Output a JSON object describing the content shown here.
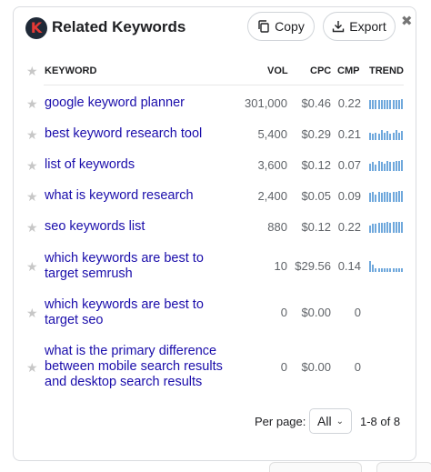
{
  "header": {
    "logo_letter": "K",
    "title": "Related Keywords",
    "copy_label": "Copy",
    "export_label": "Export",
    "close_glyph": "✖"
  },
  "columns": {
    "keyword": "KEYWORD",
    "vol": "VOL",
    "cpc": "CPC",
    "cmp": "CMP",
    "trend": "TREND"
  },
  "rows": [
    {
      "keyword": "google keyword planner",
      "vol": "301,000",
      "cpc": "$0.46",
      "cmp": "0.22",
      "trend": [
        8,
        8,
        8,
        8,
        8,
        8,
        8,
        8,
        8,
        8,
        8,
        9
      ]
    },
    {
      "keyword": "best keyword research tool",
      "vol": "5,400",
      "cpc": "$0.29",
      "cmp": "0.21",
      "trend": [
        7,
        6,
        7,
        6,
        9,
        7,
        8,
        6,
        7,
        9,
        7,
        8
      ]
    },
    {
      "keyword": "list of keywords",
      "vol": "3,600",
      "cpc": "$0.12",
      "cmp": "0.07",
      "trend": [
        7,
        8,
        6,
        9,
        8,
        7,
        9,
        8,
        8,
        9,
        9,
        10
      ]
    },
    {
      "keyword": "what is keyword research",
      "vol": "2,400",
      "cpc": "$0.05",
      "cmp": "0.09",
      "trend": [
        8,
        9,
        7,
        9,
        8,
        9,
        9,
        8,
        9,
        9,
        10,
        10
      ]
    },
    {
      "keyword": "seo keywords list",
      "vol": "880",
      "cpc": "$0.12",
      "cmp": "0.22",
      "trend": [
        7,
        8,
        8,
        9,
        9,
        9,
        10,
        9,
        10,
        10,
        10,
        10
      ]
    },
    {
      "keyword": "which keywords are best to target semrush",
      "vol": "10",
      "cpc": "$29.56",
      "cmp": "0.14",
      "trend": [
        10,
        7,
        3,
        3,
        3,
        3,
        3,
        3,
        3,
        3,
        3,
        3
      ]
    },
    {
      "keyword": "which keywords are best to target seo",
      "vol": "0",
      "cpc": "$0.00",
      "cmp": "0",
      "trend": []
    },
    {
      "keyword": "what is the primary difference between mobile search results and desktop search results",
      "vol": "0",
      "cpc": "$0.00",
      "cmp": "0",
      "trend": []
    }
  ],
  "pager": {
    "label": "Per page:",
    "selected": "All",
    "range": "1-8 of 8"
  },
  "colors": {
    "link": "#1a0dab",
    "trend_bar": "#6fa8dc",
    "logo_accent": "#e53935"
  }
}
